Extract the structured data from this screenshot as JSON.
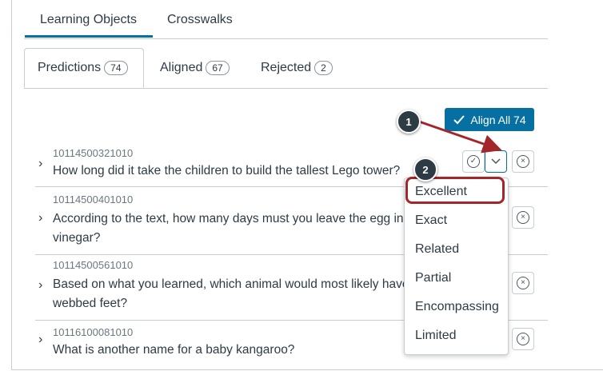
{
  "top_tabs": [
    {
      "label": "Learning Objects",
      "active": true
    },
    {
      "label": "Crosswalks",
      "active": false
    }
  ],
  "sub_tabs": [
    {
      "label": "Predictions",
      "count": "74",
      "active": true
    },
    {
      "label": "Aligned",
      "count": "67",
      "active": false
    },
    {
      "label": "Rejected",
      "count": "2",
      "active": false
    }
  ],
  "align_all_button": {
    "label": "Align All 74"
  },
  "rows": [
    {
      "code": "10114500321010",
      "question": "How long did it take the children to build the tallest Lego tower?",
      "question_line2": ""
    },
    {
      "code": "10114500401010",
      "question": "According to the text, how many days must you leave the egg in",
      "question_line2": "vinegar?"
    },
    {
      "code": "10114500561010",
      "question": "Based on what you learned, which animal would most likely have",
      "question_line2": "webbed feet?"
    },
    {
      "code": "10116100081010",
      "question": "What is another name for a baby kangaroo?",
      "question_line2": ""
    }
  ],
  "alignment_menu": {
    "options": [
      "Excellent",
      "Exact",
      "Related",
      "Partial",
      "Encompassing",
      "Limited"
    ],
    "highlighted": "Excellent"
  },
  "callouts": [
    "1",
    "2"
  ],
  "colors": {
    "accent": "#0770a3",
    "highlight": "#a3262a",
    "text": "#2d3b45"
  }
}
